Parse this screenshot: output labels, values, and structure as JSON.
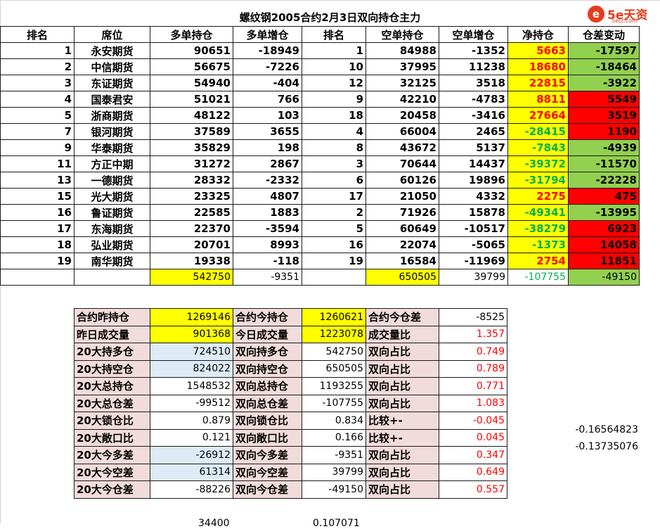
{
  "title": "螺纹钢2005合约2月3日双向持仓主力",
  "logo": {
    "mark": "e",
    "brand": "5e天资",
    "domain": "5etz.com"
  },
  "headers": [
    "排名",
    "席位",
    "多单持仓",
    "多单增仓",
    "排名",
    "空单持仓",
    "空单增仓",
    "净持仓",
    "仓差变动"
  ],
  "rows": [
    {
      "rank_long": "1",
      "broker": "永安期货",
      "long": "90651",
      "long_chg": "-18949",
      "rank_short": "1",
      "short": "84988",
      "short_chg": "-1352",
      "net": "5663",
      "net_color": "red",
      "diff": "-17597",
      "diff_bg": "grn"
    },
    {
      "rank_long": "2",
      "broker": "中信期货",
      "long": "56675",
      "long_chg": "-7226",
      "rank_short": "10",
      "short": "37995",
      "short_chg": "11238",
      "net": "18680",
      "net_color": "red",
      "diff": "-18464",
      "diff_bg": "grn"
    },
    {
      "rank_long": "3",
      "broker": "东证期货",
      "long": "54940",
      "long_chg": "-404",
      "rank_short": "12",
      "short": "32125",
      "short_chg": "3518",
      "net": "22815",
      "net_color": "red",
      "diff": "-3922",
      "diff_bg": "grn"
    },
    {
      "rank_long": "4",
      "broker": "国泰君安",
      "long": "51021",
      "long_chg": "766",
      "rank_short": "9",
      "short": "42210",
      "short_chg": "-4783",
      "net": "8811",
      "net_color": "red",
      "diff": "5549",
      "diff_bg": "red"
    },
    {
      "rank_long": "5",
      "broker": "浙商期货",
      "long": "48122",
      "long_chg": "103",
      "rank_short": "18",
      "short": "20458",
      "short_chg": "-3416",
      "net": "27664",
      "net_color": "red",
      "diff": "3519",
      "diff_bg": "red"
    },
    {
      "rank_long": "7",
      "broker": "银河期货",
      "long": "37589",
      "long_chg": "3655",
      "rank_short": "4",
      "short": "66004",
      "short_chg": "2465",
      "net": "-28415",
      "net_color": "grn",
      "diff": "1190",
      "diff_bg": "red"
    },
    {
      "rank_long": "9",
      "broker": "华泰期货",
      "long": "35829",
      "long_chg": "198",
      "rank_short": "8",
      "short": "43672",
      "short_chg": "5137",
      "net": "-7843",
      "net_color": "grn",
      "diff": "-4939",
      "diff_bg": "grn"
    },
    {
      "rank_long": "11",
      "broker": "方正中期",
      "long": "31272",
      "long_chg": "2867",
      "rank_short": "3",
      "short": "70644",
      "short_chg": "14437",
      "net": "-39372",
      "net_color": "grn",
      "diff": "-11570",
      "diff_bg": "grn"
    },
    {
      "rank_long": "13",
      "broker": "一德期货",
      "long": "28332",
      "long_chg": "-2332",
      "rank_short": "6",
      "short": "60126",
      "short_chg": "19896",
      "net": "-31794",
      "net_color": "grn",
      "diff": "-22228",
      "diff_bg": "grn"
    },
    {
      "rank_long": "15",
      "broker": "光大期货",
      "long": "23325",
      "long_chg": "4807",
      "rank_short": "17",
      "short": "21050",
      "short_chg": "4332",
      "net": "2275",
      "net_color": "red",
      "diff": "475",
      "diff_bg": "red"
    },
    {
      "rank_long": "16",
      "broker": "鲁证期货",
      "long": "22585",
      "long_chg": "1883",
      "rank_short": "2",
      "short": "71926",
      "short_chg": "15878",
      "net": "-49341",
      "net_color": "grn",
      "diff": "-13995",
      "diff_bg": "grn"
    },
    {
      "rank_long": "17",
      "broker": "东海期货",
      "long": "22370",
      "long_chg": "-3594",
      "rank_short": "5",
      "short": "60649",
      "short_chg": "-10517",
      "net": "-38279",
      "net_color": "grn",
      "diff": "6923",
      "diff_bg": "red"
    },
    {
      "rank_long": "18",
      "broker": "弘业期货",
      "long": "20701",
      "long_chg": "8993",
      "rank_short": "16",
      "short": "22074",
      "short_chg": "-5065",
      "net": "-1373",
      "net_color": "grn",
      "diff": "14058",
      "diff_bg": "red"
    },
    {
      "rank_long": "19",
      "broker": "南华期货",
      "long": "19338",
      "long_chg": "-118",
      "rank_short": "19",
      "short": "16584",
      "short_chg": "-11969",
      "net": "2754",
      "net_color": "red",
      "diff": "11851",
      "diff_bg": "red"
    }
  ],
  "totals": {
    "long": "542750",
    "long_chg": "-9351",
    "short": "650505",
    "short_chg": "39799",
    "net": "-107755",
    "diff": "-49150"
  },
  "stats": [
    {
      "l1": "合约昨持仓",
      "v1": "1269146",
      "b1": "yel",
      "l2": "合约今持仓",
      "v2": "1260621",
      "b2": "yel",
      "l3": "合约今仓差",
      "v3": "-8525",
      "red3": false
    },
    {
      "l1": "昨日成交量",
      "v1": "901368",
      "b1": "yel",
      "l2": "今日成交量",
      "v2": "1223078",
      "b2": "yel",
      "l3": "成交量比",
      "v3": "1.357",
      "red3": true
    },
    {
      "l1": "20大持多仓",
      "v1": "724510",
      "b1": "lb",
      "l2": "双向持多仓",
      "v2": "542750",
      "b2": "",
      "l3": "双向占比",
      "v3": "0.749",
      "red3": true
    },
    {
      "l1": "20大持空仓",
      "v1": "824022",
      "b1": "lb",
      "l2": "双向持空仓",
      "v2": "650505",
      "b2": "",
      "l3": "双向占比",
      "v3": "0.789",
      "red3": true
    },
    {
      "l1": "20大总持仓",
      "v1": "1548532",
      "b1": "",
      "l2": "双向总持仓",
      "v2": "1193255",
      "b2": "",
      "l3": "双向占比",
      "v3": "0.771",
      "red3": true
    },
    {
      "l1": "20大总仓差",
      "v1": "-99512",
      "b1": "",
      "l2": "双向总仓差",
      "v2": "-107755",
      "b2": "",
      "l3": "双向占比",
      "v3": "1.083",
      "red3": true
    },
    {
      "l1": "20大锁仓比",
      "v1": "0.879",
      "b1": "",
      "l2": "双向锁仓比",
      "v2": "0.834",
      "b2": "",
      "l3": "比较+-",
      "v3": "-0.045",
      "red3": true
    },
    {
      "l1": "20大敞口比",
      "v1": "0.121",
      "b1": "",
      "l2": "双向敞口比",
      "v2": "0.166",
      "b2": "",
      "l3": "比较+-",
      "v3": "0.045",
      "red3": true
    },
    {
      "l1": "20大今多差",
      "v1": "-26912",
      "b1": "lb",
      "l2": "双向今多差",
      "v2": "-9351",
      "b2": "",
      "l3": "双向占比",
      "v3": "0.347",
      "red3": true
    },
    {
      "l1": "20大今空差",
      "v1": "61314",
      "b1": "lb",
      "l2": "双向今空差",
      "v2": "39799",
      "b2": "",
      "l3": "双向占比",
      "v3": "0.649",
      "red3": true
    },
    {
      "l1": "20大今仓差",
      "v1": "-88226",
      "b1": "",
      "l2": "双向今仓差",
      "v2": "-49150",
      "b2": "",
      "l3": "双向占比",
      "v3": "0.557",
      "red3": true
    }
  ],
  "extra": {
    "v1": "-0.16564823",
    "v2": "-0.13735076"
  },
  "cutoff": {
    "a": "34400",
    "b": "0.107071"
  }
}
